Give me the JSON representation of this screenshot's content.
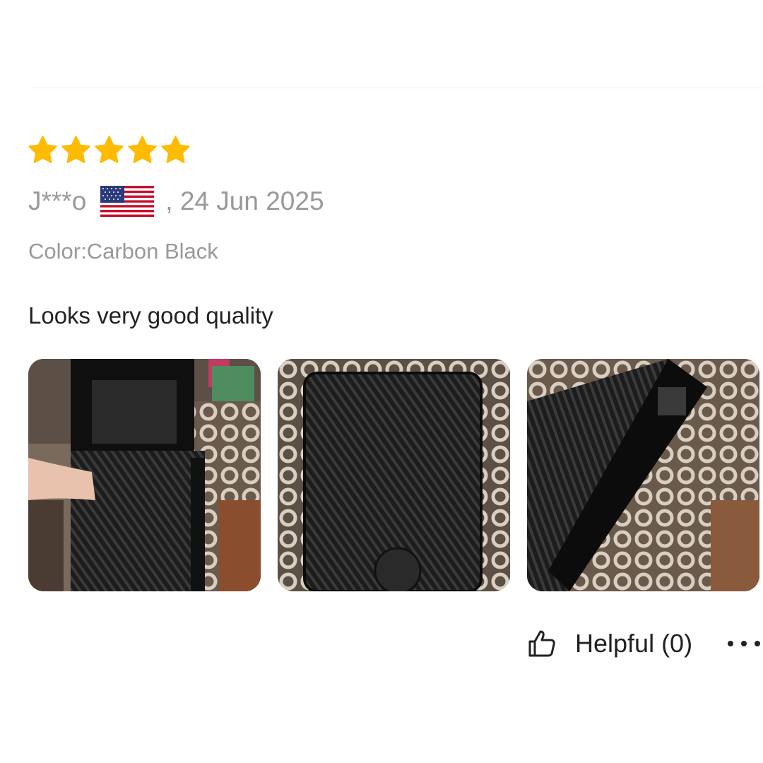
{
  "review": {
    "rating": 5,
    "rating_max": 5,
    "star_color": "#FFBB00",
    "reviewer": "J***o",
    "country_flag_icon": "us-flag-icon",
    "date": ", 24 Jun 2025",
    "color_variant": "Color:Carbon Black",
    "text": "Looks very good quality",
    "photos": [
      {
        "subject": "wallet-photo-open"
      },
      {
        "subject": "wallet-photo-front"
      },
      {
        "subject": "wallet-photo-side"
      }
    ],
    "helpful_label": "Helpful (0)",
    "helpful_icon": "thumbs-up-icon",
    "more_icon": "more-dots-icon"
  }
}
